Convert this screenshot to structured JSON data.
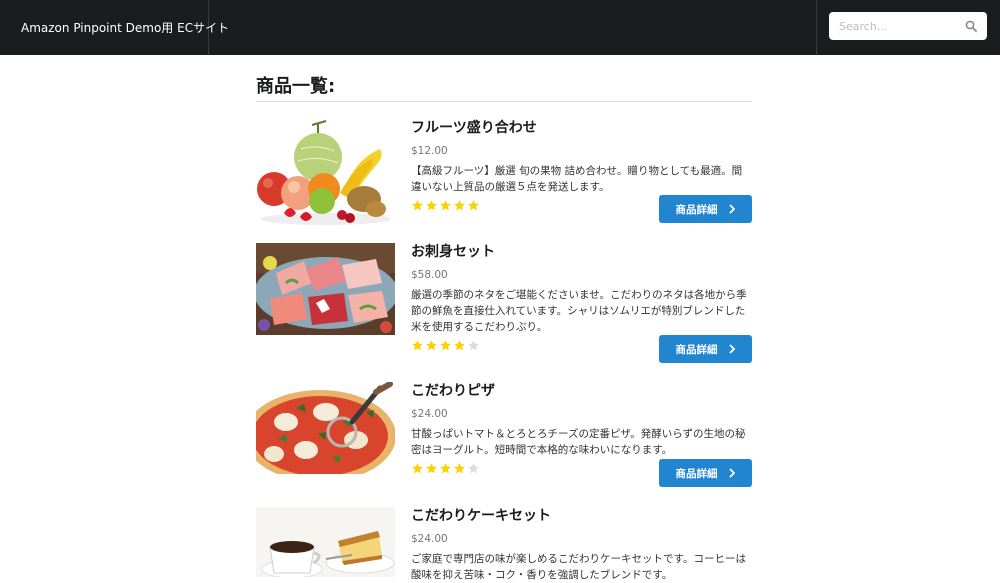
{
  "header": {
    "brand": "Amazon Pinpoint Demo用 ECサイト",
    "search_placeholder": "Search..."
  },
  "page": {
    "title": "商品一覧:"
  },
  "products": [
    {
      "name": "フルーツ盛り合わせ",
      "price": "$12.00",
      "description": "【高級フルーツ】厳選 旬の果物 詰め合わせ。贈り物としても最適。間違いない上質品の厳選５点を発送します。",
      "rating": 5,
      "rating_max": 5,
      "button": "商品詳細"
    },
    {
      "name": "お刺身セット",
      "price": "$58.00",
      "description": "厳選の季節のネタをご堪能くださいませ。こだわりのネタは各地から季節の鮮魚を直接仕入れています。シャリはソムリエが特別ブレンドした米を使用するこだわりぶり。",
      "rating": 4,
      "rating_max": 5,
      "button": "商品詳細"
    },
    {
      "name": "こだわりピザ",
      "price": "$24.00",
      "description": "甘酸っぱいトマト＆とろとろチーズの定番ピザ。発酵いらずの生地の秘密はヨーグルト。短時間で本格的な味わいになります。",
      "rating": 4,
      "rating_max": 5,
      "button": "商品詳細"
    },
    {
      "name": "こだわりケーキセット",
      "price": "$24.00",
      "description": "ご家庭で専門店の味が楽しめるこだわりケーキセットです。コーヒーは酸味を抑え苦味・コク・香りを強調したブレンドです。"
    }
  ],
  "colors": {
    "topbar": "#1b1c1d",
    "button": "#2185d0",
    "star_on": "#fbd100",
    "star_off": "#dcdcdc"
  }
}
